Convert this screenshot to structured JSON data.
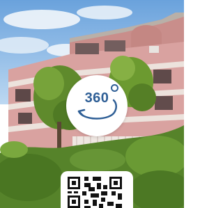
{
  "listing_photo": {
    "badge_text": "360",
    "badge_icon": "rotate-360-icon",
    "qr_icon": "qr-code-icon",
    "colors": {
      "accent": "#2f5f96",
      "badge_bg": "#ffffff",
      "facade": "#d9a2a0"
    }
  }
}
